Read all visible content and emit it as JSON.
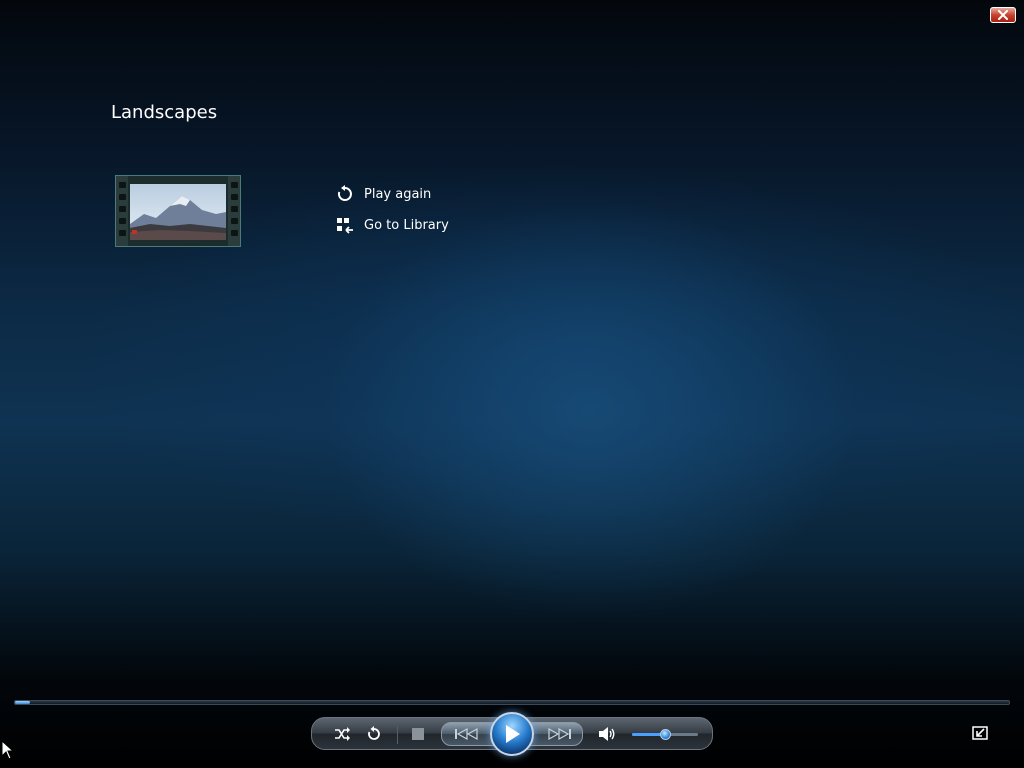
{
  "playlist": {
    "title": "Landscapes"
  },
  "actions": [
    {
      "label": "Play again",
      "icon": "replay-icon"
    },
    {
      "label": "Go to Library",
      "icon": "library-icon"
    }
  ],
  "seek": {
    "progress_fraction": 0.015
  },
  "controls": {
    "buttons": [
      "shuffle-icon",
      "repeat-icon",
      "stop-icon",
      "previous-icon",
      "play-icon",
      "next-icon",
      "volume-icon"
    ],
    "volume_fraction": 0.5
  },
  "colors": {
    "accent": "#3c8ad8",
    "close_button": "#c8432f"
  }
}
